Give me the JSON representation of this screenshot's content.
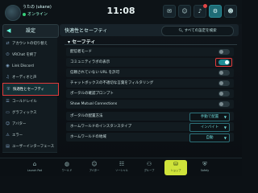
{
  "top": {
    "user_name": "うたの (ukane)",
    "user_status": "オンライン",
    "time": "11:08",
    "icons": [
      "mail-icon",
      "friend-icon",
      "bell-icon",
      "gear-icon",
      "user-icon"
    ]
  },
  "sidebar": {
    "title": "設定",
    "items": [
      {
        "label": "アカウントの切り替え",
        "icon": "swap-icon"
      },
      {
        "label": "VRChat を終了",
        "icon": "power-icon"
      },
      {
        "label": "Link Discord",
        "icon": "discord-icon"
      },
      {
        "label": "オーディオと声",
        "icon": "speaker-icon"
      },
      {
        "label": "快適性とセーフティ",
        "icon": "shield-icon"
      },
      {
        "label": "コールドレイル",
        "icon": "rail-icon"
      },
      {
        "label": "グラフィックス",
        "icon": "display-icon"
      },
      {
        "label": "アバター",
        "icon": "avatar-icon"
      },
      {
        "label": "ユーザーインターフェース",
        "icon": "ui-icon"
      }
    ],
    "partial_items": [
      "エラー"
    ]
  },
  "panel": {
    "title": "快適性とセーフティ",
    "search_all": "すべての設定を検索",
    "section": "セーフティ",
    "rows": [
      {
        "label": "配信者モード",
        "type": "toggle",
        "on": false
      },
      {
        "label": "コミュニティラボの表示",
        "type": "toggle",
        "on": true,
        "highlight": true
      },
      {
        "label": "信頼されていない URL を許可",
        "type": "toggle",
        "on": false
      },
      {
        "label": "チャットボックスの不適切な言葉をフィルタリング",
        "type": "toggle",
        "on": false
      },
      {
        "label": "ポータルの確認プロンプト",
        "type": "toggle",
        "on": false
      },
      {
        "label": "Show Mutual Connections",
        "type": "toggle",
        "on": false
      },
      {
        "label": "ポータルの配置方法",
        "type": "select",
        "value": "手動で配置"
      },
      {
        "label": "ホームワールドのインスタンスタイプ",
        "type": "select",
        "value": "インバイト"
      },
      {
        "label": "ホームワールドの地域",
        "type": "select",
        "value": "自動"
      }
    ]
  },
  "bottom_nav": [
    {
      "label": "Launch Pad",
      "icon": "home-icon"
    },
    {
      "label": "ワールド",
      "icon": "globe-icon"
    },
    {
      "label": "アバター",
      "icon": "avatar-icon"
    },
    {
      "label": "ソーシャル",
      "icon": "people-icon"
    },
    {
      "label": "グループ",
      "icon": "group-icon"
    },
    {
      "label": "ショップ",
      "icon": "shop-icon",
      "active": true
    },
    {
      "label": "Safety",
      "icon": "shield-icon"
    }
  ],
  "colors": {
    "accent": "#1f8e97",
    "highlight": "#e03a3a",
    "active_nav": "#cfe33a"
  }
}
